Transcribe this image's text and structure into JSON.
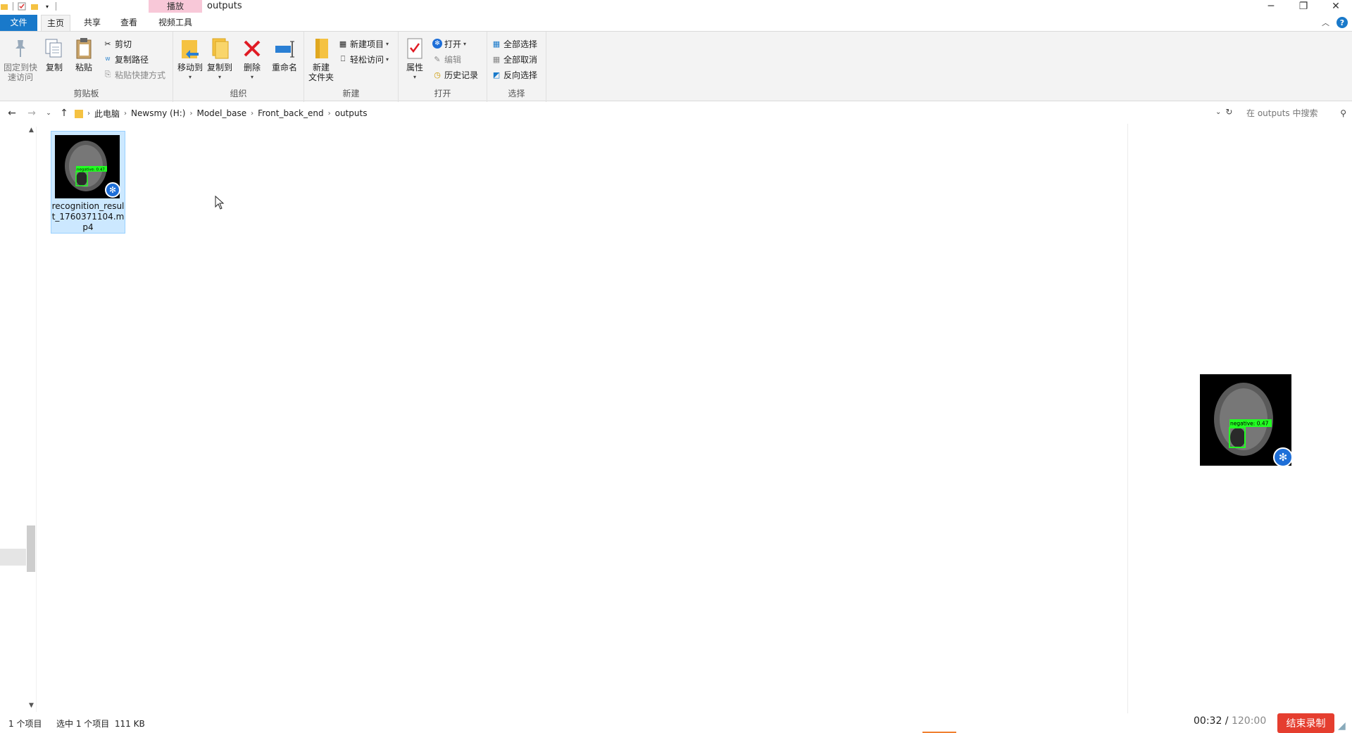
{
  "window": {
    "context_tab_header": "播放",
    "title": "outputs"
  },
  "ribbon_tabs": {
    "file": "文件",
    "home": "主页",
    "share": "共享",
    "view": "查看",
    "video_tools": "视频工具"
  },
  "clipboard": {
    "pin": "固定到快\n速访问",
    "copy": "复制",
    "paste": "粘贴",
    "cut": "剪切",
    "copy_path": "复制路径",
    "paste_shortcut": "粘贴快捷方式",
    "label": "剪贴板"
  },
  "organize": {
    "move_to": "移动到",
    "copy_to": "复制到",
    "delete": "删除",
    "rename": "重命名",
    "label": "组织"
  },
  "new_group": {
    "new_folder": "新建\n文件夹",
    "new_item": "新建项目",
    "easy_access": "轻松访问",
    "label": "新建"
  },
  "open_group": {
    "properties": "属性",
    "open": "打开",
    "edit": "编辑",
    "history": "历史记录",
    "label": "打开"
  },
  "select_group": {
    "select_all": "全部选择",
    "select_none": "全部取消",
    "invert": "反向选择",
    "label": "选择"
  },
  "address": {
    "crumbs": [
      "此电脑",
      "Newsmy (H:)",
      "Model_base",
      "Front_back_end",
      "outputs"
    ],
    "search_placeholder": "在 outputs 中搜索"
  },
  "files": [
    {
      "name": "recognition_result_1760371104.mp4",
      "label": "negative: 0.47",
      "selected": true
    }
  ],
  "preview": {
    "label": "negative: 0.47"
  },
  "status": {
    "item_count": "1 个项目",
    "selection": "选中 1 个项目  111 KB"
  },
  "recorder": {
    "elapsed": "00:32",
    "separator": " / ",
    "total": "120:00",
    "stop_label": "结束录制"
  },
  "colors": {
    "accent": "#1979ca",
    "selection_bg": "#cce8ff",
    "context_tab": "#f8c8d8",
    "record_button": "#e53e2f",
    "detection_box": "#22ff22"
  }
}
